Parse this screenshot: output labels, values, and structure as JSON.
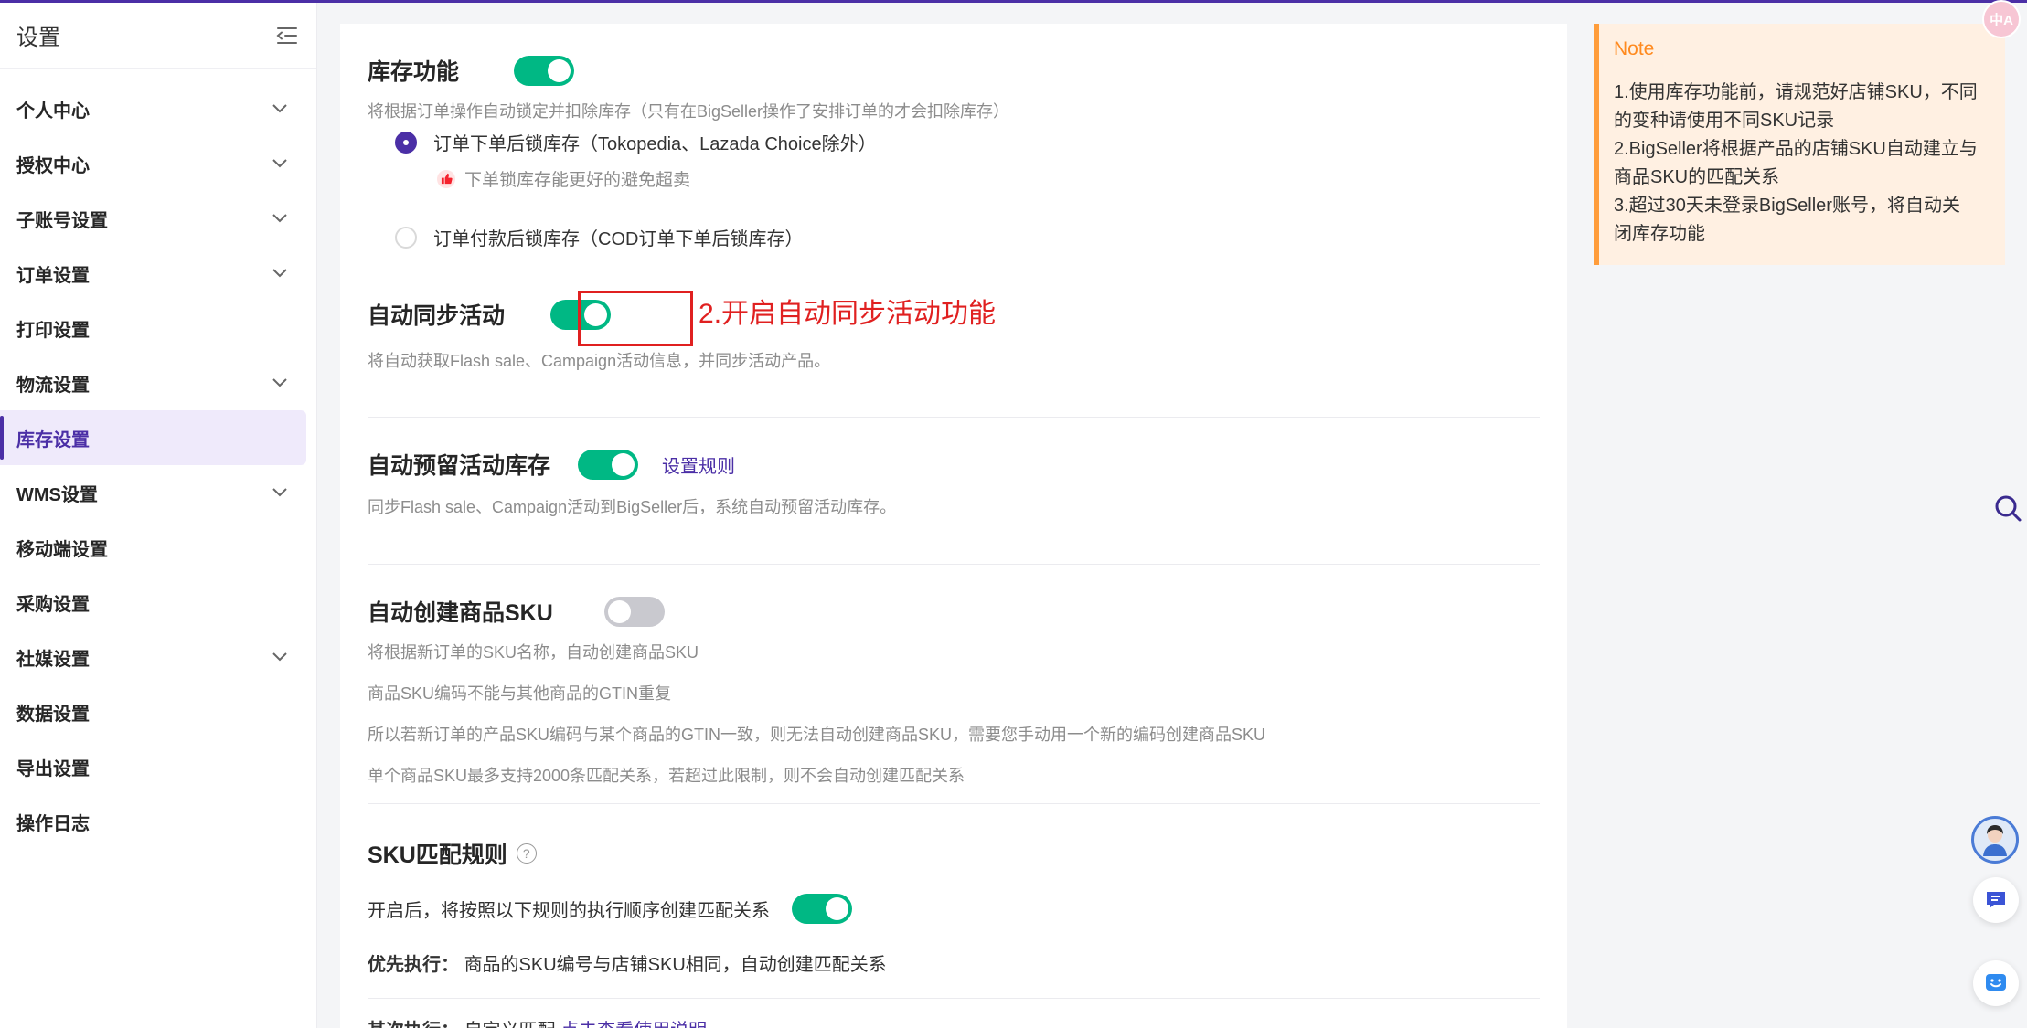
{
  "sidebar": {
    "title": "设置",
    "items": [
      {
        "label": "个人中心",
        "chevron": true
      },
      {
        "label": "授权中心",
        "chevron": true
      },
      {
        "label": "子账号设置",
        "chevron": true
      },
      {
        "label": "订单设置",
        "chevron": true
      },
      {
        "label": "打印设置",
        "chevron": false
      },
      {
        "label": "物流设置",
        "chevron": true
      },
      {
        "label": "库存设置",
        "chevron": false,
        "active": true
      },
      {
        "label": "WMS设置",
        "chevron": true
      },
      {
        "label": "移动端设置",
        "chevron": false
      },
      {
        "label": "采购设置",
        "chevron": false
      },
      {
        "label": "社媒设置",
        "chevron": true
      },
      {
        "label": "数据设置",
        "chevron": false
      },
      {
        "label": "导出设置",
        "chevron": false
      },
      {
        "label": "操作日志",
        "chevron": false
      }
    ]
  },
  "inventory": {
    "title": "库存功能",
    "enabled": true,
    "desc": "将根据订单操作自动锁定并扣除库存（只有在BigSeller操作了安排订单的才会扣除库存）",
    "option1": "订单下单后锁库存（Tokopedia、Lazada Choice除外）",
    "option1_tip": "下单锁库存能更好的避免超卖",
    "option2": "订单付款后锁库存（COD订单下单后锁库存）"
  },
  "auto_sync": {
    "title": "自动同步活动",
    "enabled": true,
    "annotation": "2.开启自动同步活动功能",
    "desc": "将自动获取Flash sale、Campaign活动信息，并同步活动产品。"
  },
  "auto_reserve": {
    "title": "自动预留活动库存",
    "enabled": true,
    "link": "设置规则",
    "desc": "同步Flash sale、Campaign活动到BigSeller后，系统自动预留活动库存。"
  },
  "auto_create_sku": {
    "title": "自动创建商品SKU",
    "enabled": false,
    "desc1": "将根据新订单的SKU名称，自动创建商品SKU",
    "desc2": "商品SKU编码不能与其他商品的GTIN重复",
    "desc3": "所以若新订单的产品SKU编码与某个商品的GTIN一致，则无法自动创建商品SKU，需要您手动用一个新的编码创建商品SKU",
    "desc4": "单个商品SKU最多支持2000条匹配关系，若超过此限制，则不会自动创建匹配关系"
  },
  "sku_match": {
    "title": "SKU匹配规则",
    "enable_text": "开启后，将按照以下规则的执行顺序创建匹配关系",
    "enabled": true,
    "priority_label": "优先执行：",
    "priority_text": "商品的SKU编号与店铺SKU相同，自动创建匹配关系",
    "second_label": "其次执行：",
    "second_text": "自定义匹配",
    "second_link": "点击查看使用说明"
  },
  "note": {
    "title": "Note",
    "lines": [
      "1.使用库存功能前，请规范好店铺SKU，不同",
      "的变种请使用不同SKU记录",
      "2.BigSeller将根据产品的店铺SKU自动建立与",
      "商品SKU的匹配关系",
      "3.超过30天未登录BigSeller账号，将自动关",
      "闭库存功能"
    ]
  },
  "floating": {
    "translate_badge": "中A"
  },
  "colors": {
    "primary": "#4b2fa6",
    "toggle_on": "#00b884",
    "annotation_red": "#e02020",
    "note_bg": "#fff0e2",
    "note_accent": "#ff9d3b"
  }
}
